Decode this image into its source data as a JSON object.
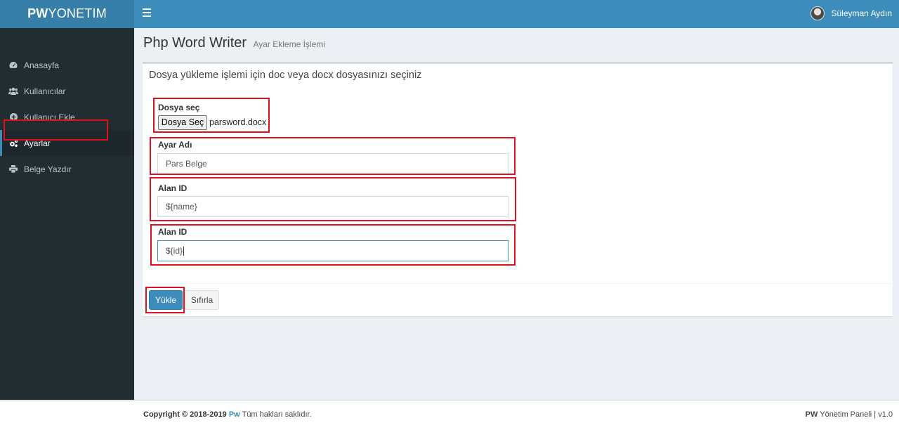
{
  "brand": {
    "bold": "PW",
    "rest": "YONETIM"
  },
  "header": {
    "user_name": "Süleyman Aydın"
  },
  "sidebar": {
    "items": [
      {
        "label": "Anasayfa",
        "icon": "dashboard-icon"
      },
      {
        "label": "Kullanıcılar",
        "icon": "users-icon"
      },
      {
        "label": "Kullanıcı Ekle",
        "icon": "plus-circle-icon"
      },
      {
        "label": "Ayarlar",
        "icon": "cogs-icon",
        "active": true
      },
      {
        "label": "Belge Yazdır",
        "icon": "print-icon"
      }
    ]
  },
  "page": {
    "title": "Php Word Writer",
    "subtitle": "Ayar Ekleme İşlemi"
  },
  "form": {
    "heading": "Dosya yükleme işlemi için doc veya docx dosyasınızı seçiniz",
    "file_label": "Dosya seç",
    "file_button": "Dosya Seç",
    "file_name": "parsword.docx",
    "ayar_label": "Ayar Adı",
    "ayar_value": "Pars Belge",
    "alan1_label": "Alan ID",
    "alan1_value": "${name}",
    "alan2_label": "Alan ID",
    "alan2_value": "${id}",
    "submit_label": "Yükle",
    "reset_label": "Sıfırla"
  },
  "footer": {
    "copyright_prefix": "Copyright © 2018-2019",
    "copyright_brand": "Pw",
    "copyright_suffix": "Tüm hakları saklıdır.",
    "right_bold": "PW",
    "right_text": "Yönetim Paneli | v1.0"
  },
  "colors": {
    "accent": "#3c8dbc",
    "sidebar": "#222d32",
    "highlight": "#e0101e"
  }
}
